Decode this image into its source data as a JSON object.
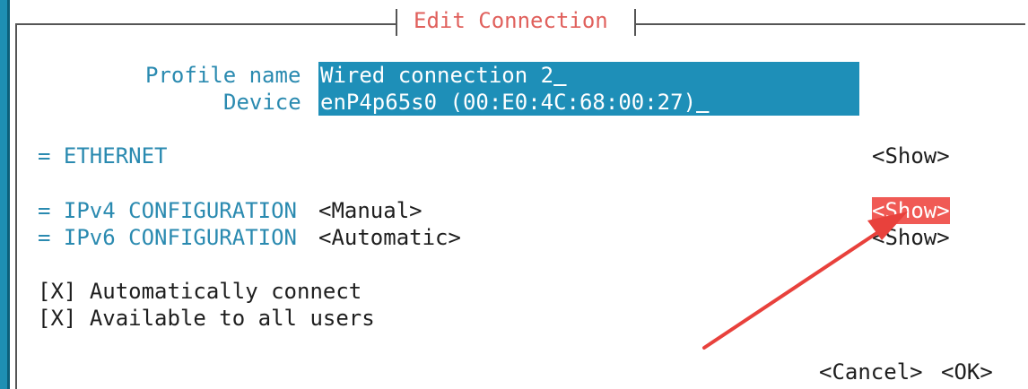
{
  "dialog": {
    "title": "Edit Connection"
  },
  "profile": {
    "label": "Profile name",
    "value": "Wired connection 2"
  },
  "device": {
    "label": "Device",
    "value": "enP4p65s0 (00:E0:4C:68:00:27)"
  },
  "ethernet": {
    "label": "= ETHERNET",
    "action": "<Show>"
  },
  "ipv4": {
    "label": "= IPv4 CONFIGURATION",
    "mode": "<Manual>",
    "action": "<Show>"
  },
  "ipv6": {
    "label": "= IPv6 CONFIGURATION",
    "mode": "<Automatic>",
    "action": "<Show>"
  },
  "options": [
    {
      "checkbox": "[X]",
      "label": "Automatically connect"
    },
    {
      "checkbox": "[X]",
      "label": "Available to all users"
    }
  ],
  "buttons": {
    "cancel": "<Cancel>",
    "ok": "<OK>"
  },
  "colors": {
    "accent": "#1e8fb8",
    "highlight": "#f05a55",
    "arrow": "#e8413c"
  }
}
